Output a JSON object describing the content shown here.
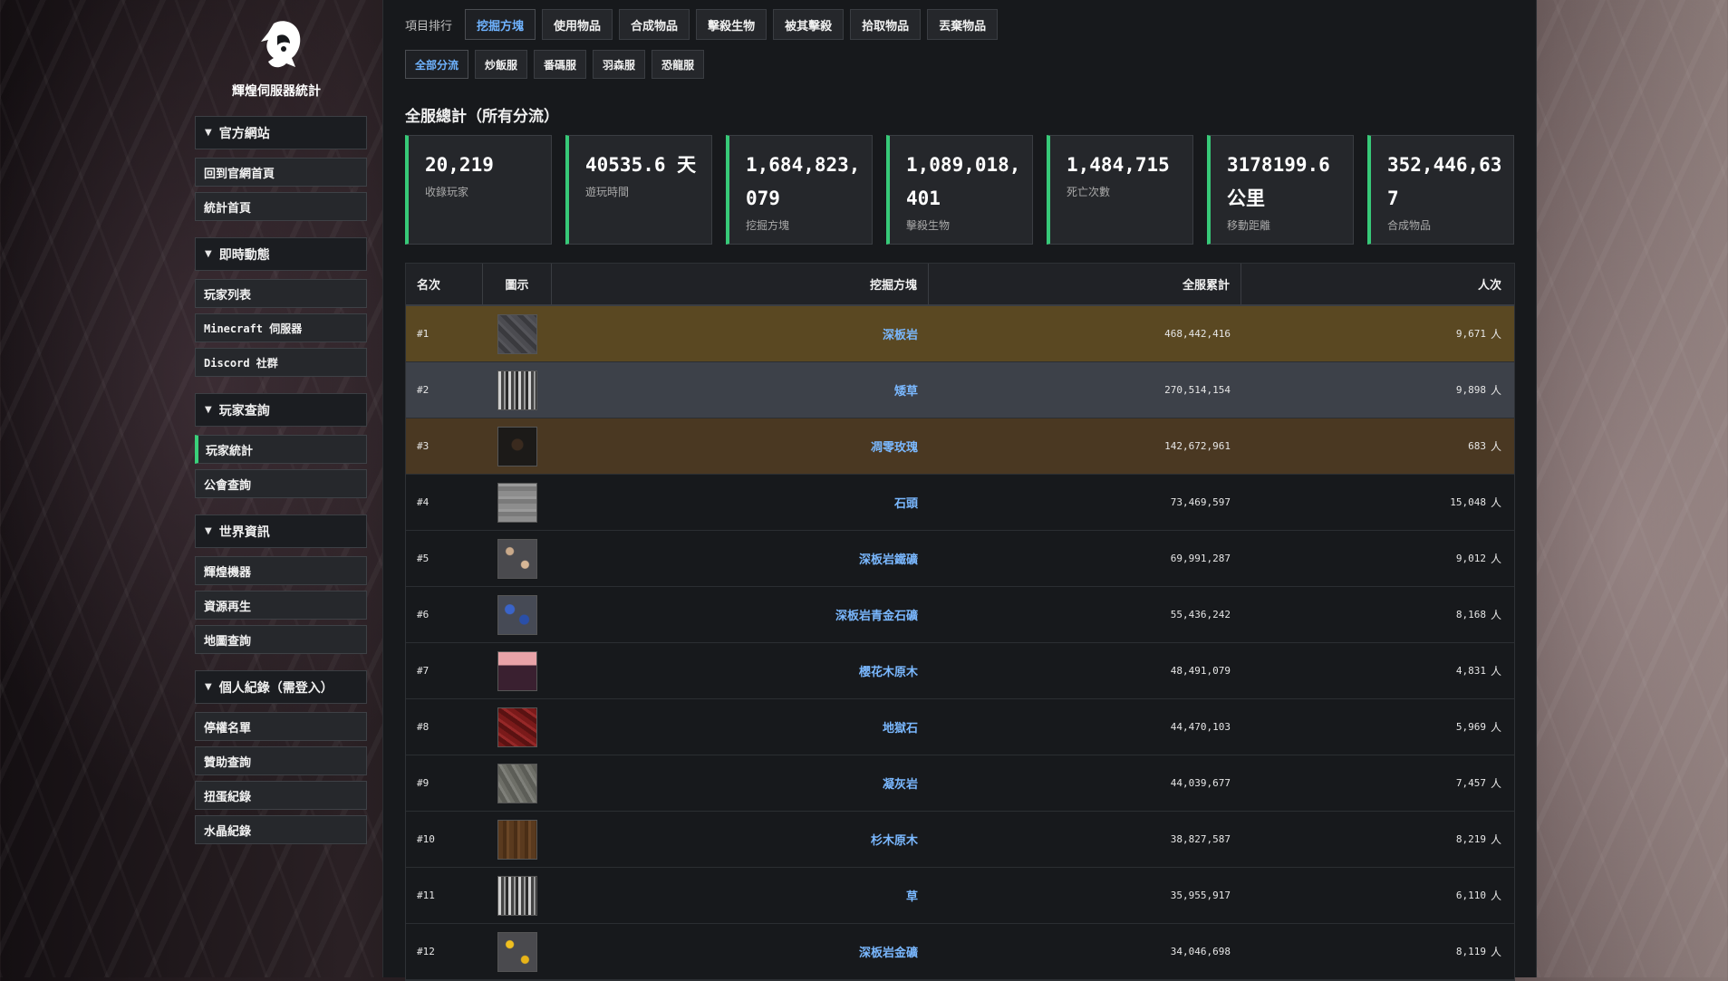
{
  "site": {
    "title": "輝煌伺服器統計"
  },
  "sidebar": {
    "groups": [
      {
        "header": "官方網站",
        "items": [
          "回到官網首頁",
          "統計首頁"
        ]
      },
      {
        "header": "即時動態",
        "items": [
          "玩家列表",
          "Minecraft 伺服器",
          "Discord 社群"
        ]
      },
      {
        "header": "玩家查詢",
        "items": [
          "玩家統計",
          "公會查詢"
        ]
      },
      {
        "header": "世界資訊",
        "items": [
          "輝煌機器",
          "資源再生",
          "地圖查詢"
        ]
      },
      {
        "header": "個人紀錄（需登入）",
        "items": [
          "停權名單",
          "贊助查詢",
          "扭蛋紀錄",
          "水晶紀錄"
        ]
      }
    ]
  },
  "tabs": {
    "label": "項目排行",
    "main": [
      "挖掘方塊",
      "使用物品",
      "合成物品",
      "擊殺生物",
      "被其擊殺",
      "拾取物品",
      "丟棄物品"
    ],
    "sub": [
      "全部分流",
      "炒飯服",
      "番碼服",
      "羽森服",
      "恐龍服"
    ]
  },
  "summary": {
    "title": "全服總計（所有分流）",
    "stats": [
      {
        "value": "20,219",
        "label": "收錄玩家"
      },
      {
        "value": "40535.6 天",
        "label": "遊玩時間"
      },
      {
        "value": "1,684,823,079",
        "label": "挖掘方塊"
      },
      {
        "value": "1,089,018,401",
        "label": "擊殺生物"
      },
      {
        "value": "1,484,715",
        "label": "死亡次數"
      },
      {
        "value": "3178199.6 公里",
        "label": "移動距離"
      },
      {
        "value": "352,446,637",
        "label": "合成物品"
      }
    ]
  },
  "table": {
    "headers": {
      "rank": "名次",
      "icon": "圖示",
      "name": "挖掘方塊",
      "total": "全服累計",
      "count": "人次"
    },
    "unit": "人",
    "rows": [
      {
        "rank": "#1",
        "name": "深板岩",
        "total": "468,442,416",
        "count": "9,671",
        "block": "deepslate"
      },
      {
        "rank": "#2",
        "name": "矮草",
        "total": "270,514,154",
        "count": "9,898",
        "block": "grass"
      },
      {
        "rank": "#3",
        "name": "凋零玫瑰",
        "total": "142,672,961",
        "count": "683",
        "block": "wither-rose"
      },
      {
        "rank": "#4",
        "name": "石頭",
        "total": "73,469,597",
        "count": "15,048",
        "block": "stone"
      },
      {
        "rank": "#5",
        "name": "深板岩鐵礦",
        "total": "69,991,287",
        "count": "9,012",
        "block": "deepslate-iron"
      },
      {
        "rank": "#6",
        "name": "深板岩青金石礦",
        "total": "55,436,242",
        "count": "8,168",
        "block": "deepslate-lapis"
      },
      {
        "rank": "#7",
        "name": "櫻花木原木",
        "total": "48,491,079",
        "count": "4,831",
        "block": "cherry-log"
      },
      {
        "rank": "#8",
        "name": "地獄石",
        "total": "44,470,103",
        "count": "5,969",
        "block": "netherrack"
      },
      {
        "rank": "#9",
        "name": "凝灰岩",
        "total": "44,039,677",
        "count": "7,457",
        "block": "tuff"
      },
      {
        "rank": "#10",
        "name": "杉木原木",
        "total": "38,827,587",
        "count": "8,219",
        "block": "spruce-log"
      },
      {
        "rank": "#11",
        "name": "草",
        "total": "35,955,917",
        "count": "6,110",
        "block": "grass"
      },
      {
        "rank": "#12",
        "name": "深板岩金礦",
        "total": "34,046,698",
        "count": "8,119",
        "block": "deepslate-gold"
      }
    ]
  },
  "colors": {
    "accent": "#37c978",
    "link": "#7ab8ff",
    "gold": "#5a4822",
    "silver": "#3d4149",
    "bronze": "#4a3822"
  }
}
